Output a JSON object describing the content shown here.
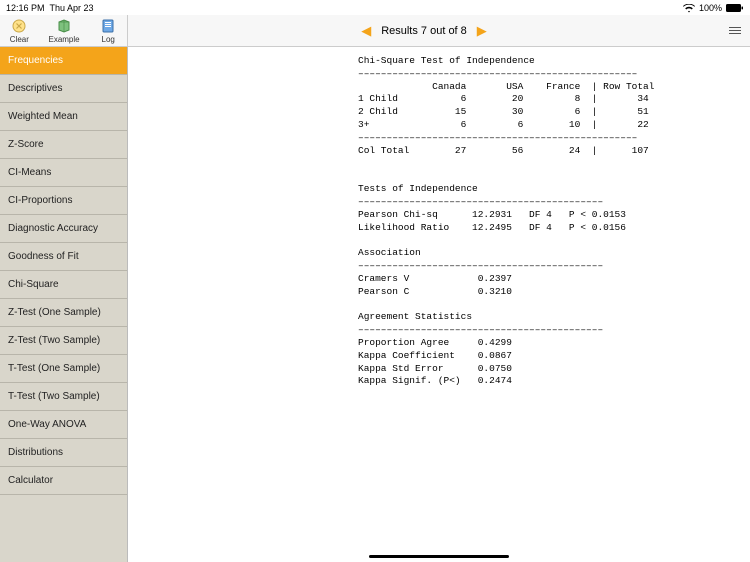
{
  "status": {
    "time": "12:16 PM",
    "date": "Thu Apr 23",
    "battery": "100%"
  },
  "toolbar": {
    "clear": "Clear",
    "example": "Example",
    "log": "Log"
  },
  "header": {
    "results_text": "Results 7 out of 8"
  },
  "sidebar": {
    "active_index": 0,
    "items": [
      "Frequencies",
      "Descriptives",
      "Weighted Mean",
      "Z-Score",
      "CI-Means",
      "CI-Proportions",
      "Diagnostic Accuracy",
      "Goodness of Fit",
      "Chi-Square",
      "Z-Test (One Sample)",
      "Z-Test (Two Sample)",
      "T-Test (One Sample)",
      "T-Test (Two Sample)",
      "One-Way ANOVA",
      "Distributions",
      "Calculator"
    ]
  },
  "output_text": "Chi-Square Test of Independence\n–––––––––––––––––––––––––––––––––––––––––––––––––\n             Canada       USA    France  | Row Total\n1 Child           6        20         8  |       34\n2 Child          15        30         6  |       51\n3+                6         6        10  |       22\n–––––––––––––––––––––––––––––––––––––––––––––––––\nCol Total        27        56        24  |      107\n\n\nTests of Independence\n–––––––––––––––––––––––––––––––––––––––––––\nPearson Chi-sq      12.2931   DF 4   P < 0.0153\nLikelihood Ratio    12.2495   DF 4   P < 0.0156\n\nAssociation\n–––––––––––––––––––––––––––––––––––––––––––\nCramers V            0.2397\nPearson C            0.3210\n\nAgreement Statistics\n–––––––––––––––––––––––––––––––––––––––––––\nProportion Agree     0.4299\nKappa Coefficient    0.0867\nKappa Std Error      0.0750\nKappa Signif. (P<)   0.2474"
}
